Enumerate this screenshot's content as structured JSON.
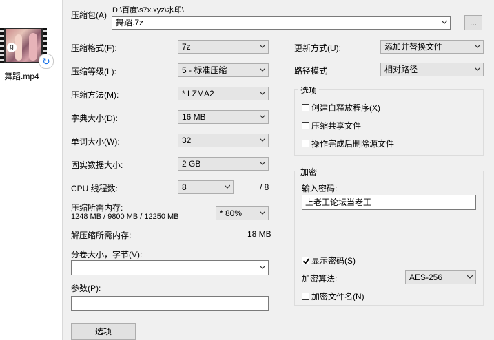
{
  "desktop": {
    "file_name": "舞蹈.mp4",
    "thumb_badge": "g",
    "sync_icon": "sync-icon"
  },
  "archive": {
    "label": "压缩包(A)",
    "path": "D:\\百度\\s7x.xyz\\水印\\",
    "name": "舞蹈.7z",
    "browse": "..."
  },
  "left": {
    "format": {
      "label": "压缩格式(F):",
      "value": "7z"
    },
    "level": {
      "label": "压缩等级(L):",
      "value": "5 - 标准压缩"
    },
    "method": {
      "label": "压缩方法(M):",
      "value": "*  LZMA2"
    },
    "dict": {
      "label": "字典大小(D):",
      "value": "16 MB"
    },
    "word": {
      "label": "单词大小(W):",
      "value": "32"
    },
    "solid": {
      "label": "固实数据大小:",
      "value": "2 GB"
    },
    "cpu": {
      "label": "CPU 线程数:",
      "value": "8",
      "max": "/ 8"
    },
    "memory": {
      "label": "压缩所需内存:",
      "detail": "1248 MB / 9800 MB / 12250 MB",
      "value": "* 80%"
    },
    "decomp": {
      "label": "解压缩所需内存:",
      "value": "18 MB"
    },
    "split": {
      "label": "分卷大小，字节(V):",
      "value": ""
    },
    "params": {
      "label": "参数(P):",
      "value": ""
    },
    "options_button": "选项"
  },
  "right": {
    "update": {
      "label": "更新方式(U):",
      "value": "添加并替换文件"
    },
    "pathmode": {
      "label": "路径模式",
      "value": "相对路径"
    },
    "options_group": {
      "title": "选项",
      "items": [
        {
          "label": "创建自释放程序(X)",
          "checked": false
        },
        {
          "label": "压缩共享文件",
          "checked": false
        },
        {
          "label": "操作完成后删除源文件",
          "checked": false
        }
      ]
    },
    "encrypt_group": {
      "title": "加密",
      "password_label": "输入密码:",
      "password": "上老王论坛当老王",
      "show_password": "显示密码(S)",
      "show_password_checked": true,
      "algo_label": "加密算法:",
      "algo": "AES-256",
      "encrypt_names": "加密文件名(N)",
      "encrypt_names_checked": false
    }
  }
}
